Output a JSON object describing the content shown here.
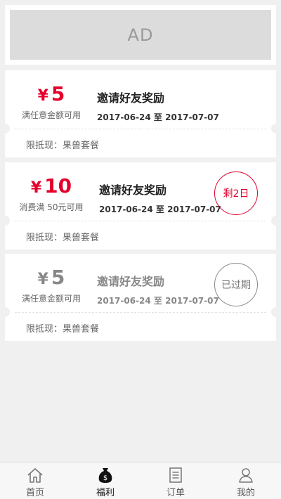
{
  "ad": {
    "label": "AD"
  },
  "coupons": [
    {
      "currency": "¥",
      "amount": "5",
      "condition": "满任意金额可用",
      "title": "邀请好友奖励",
      "date": "2017-06-24 至 2017-07-07",
      "limit": "限抵现：果兽套餐",
      "badge": ""
    },
    {
      "currency": "¥",
      "amount": "10",
      "condition": "消费满 50元可用",
      "title": "邀请好友奖励",
      "date": "2017-06-24 至 2017-07-07",
      "limit": "限抵现：果兽套餐",
      "badge": "剩2日"
    },
    {
      "currency": "¥",
      "amount": "5",
      "condition": "满任意金额可用",
      "title": "邀请好友奖励",
      "date": "2017-06-24 至 2017-07-07",
      "limit": "限抵现：果兽套餐",
      "badge": "已过期"
    }
  ],
  "tabbar": [
    {
      "label": "首页",
      "icon": "home-icon",
      "active": false
    },
    {
      "label": "福利",
      "icon": "money-bag-icon",
      "active": true
    },
    {
      "label": "订单",
      "icon": "order-list-icon",
      "active": false
    },
    {
      "label": "我的",
      "icon": "user-icon",
      "active": false
    }
  ],
  "colors": {
    "accent": "#e4002b",
    "expired": "#888888",
    "background": "#f0f0f0"
  }
}
